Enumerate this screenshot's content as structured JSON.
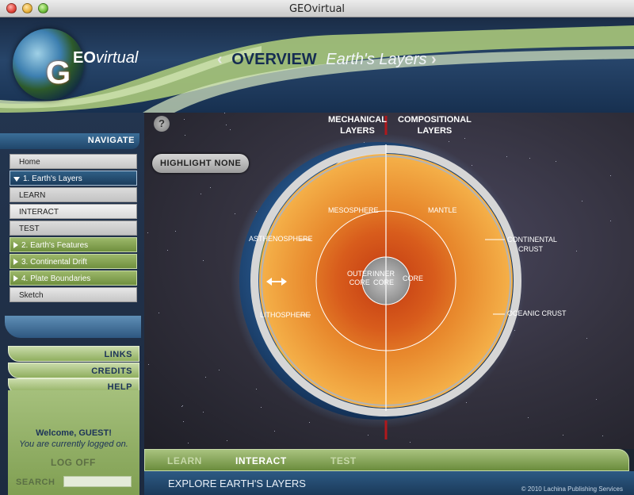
{
  "window": {
    "title": "GEOvirtual"
  },
  "header": {
    "logo_g": "G",
    "logo_eo": "EO",
    "logo_virtual": "virtual",
    "arrow_left": "‹",
    "overview": "OVERVIEW",
    "subtitle": "Earth's Layers",
    "arrow_right": "›"
  },
  "sidebar": {
    "navigate_label": "NAVIGATE",
    "items": [
      {
        "label": "Home"
      },
      {
        "label": "1. Earth's Layers"
      },
      {
        "label": "LEARN"
      },
      {
        "label": "INTERACT"
      },
      {
        "label": "TEST"
      },
      {
        "label": "2. Earth's Features"
      },
      {
        "label": "3. Continental Drift"
      },
      {
        "label": "4. Plate Boundaries"
      },
      {
        "label": "Sketch"
      }
    ],
    "links_label": "LINKS",
    "credits_label": "CREDITS",
    "help_label": "HELP",
    "welcome": "Welcome, GUEST!",
    "logged_on": "You are currently logged on.",
    "logoff": "LOG OFF",
    "search_label": "SEARCH",
    "search_value": ""
  },
  "main": {
    "help_icon": "?",
    "highlight_none": "HIGHLIGHT NONE",
    "heading_mechanical_1": "MECHANICAL",
    "heading_mechanical_2": "LAYERS",
    "heading_compositional_1": "COMPOSITIONAL",
    "heading_compositional_2": "LAYERS",
    "labels": {
      "mesosphere": "MESOSPHERE",
      "mantle": "MANTLE",
      "asthenosphere": "ASTHENOSPHERE",
      "continental_crust_1": "CONTINENTAL",
      "continental_crust_2": "CRUST",
      "outer_core_1": "OUTER",
      "outer_core_2": "CORE",
      "inner_core_1": "INNER",
      "inner_core_2": "CORE",
      "core": "CORE",
      "lithosphere": "LITHOSPHERE",
      "oceanic_crust": "OCEANIC CRUST"
    }
  },
  "tabs": {
    "learn": "LEARN",
    "interact": "INTERACT",
    "test": "TEST"
  },
  "footer": {
    "explore": "EXPLORE EARTH'S LAYERS",
    "copyright": "© 2010 Lachina Publishing Services"
  },
  "colors": {
    "accent_green": "#8fae5e",
    "navy": "#1c3358",
    "core": "#e08a2a"
  }
}
